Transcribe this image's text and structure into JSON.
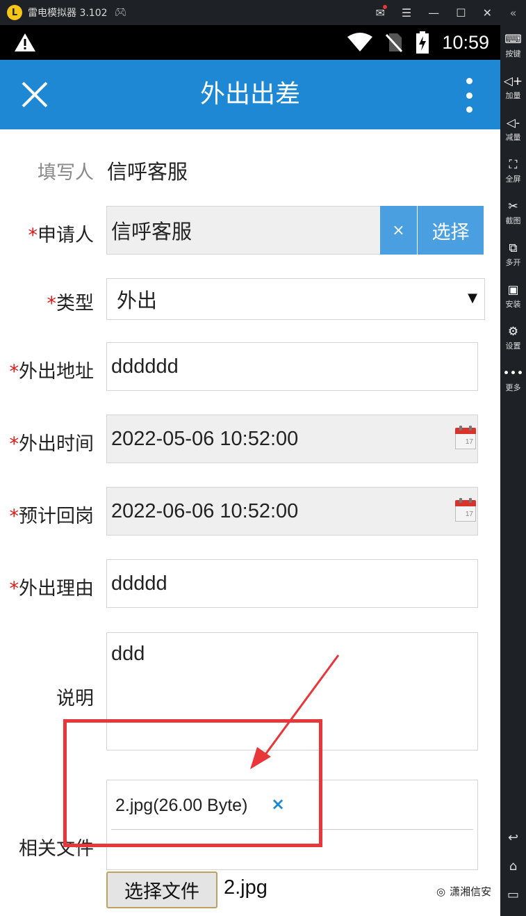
{
  "emulator": {
    "title": "雷电模拟器 3.102",
    "side_items": [
      {
        "icon": "keyboard-icon",
        "glyph": "⌨",
        "label": "按键"
      },
      {
        "icon": "volume-up-icon",
        "glyph": "◁+",
        "label": "加量"
      },
      {
        "icon": "volume-down-icon",
        "glyph": "◁-",
        "label": "减量"
      },
      {
        "icon": "fullscreen-icon",
        "glyph": "⛶",
        "label": "全屏"
      },
      {
        "icon": "scissors-icon",
        "glyph": "✂",
        "label": "截图"
      },
      {
        "icon": "multi-open-icon",
        "glyph": "⧉",
        "label": "多开"
      },
      {
        "icon": "apk-install-icon",
        "glyph": "▣",
        "label": "安装"
      },
      {
        "icon": "gear-icon",
        "glyph": "⚙",
        "label": "设置"
      },
      {
        "icon": "more-icon",
        "glyph": "•••",
        "label": "更多"
      }
    ]
  },
  "status_bar": {
    "time": "10:59"
  },
  "header": {
    "title": "外出出差"
  },
  "form": {
    "filler": {
      "label": "填写人",
      "value": "信呼客服"
    },
    "applicant": {
      "required": "*",
      "label": "申请人",
      "value": "信呼客服",
      "clear": "×",
      "choose": "选择"
    },
    "type": {
      "required": "*",
      "label": "类型",
      "value": "外出",
      "arrow": "▼"
    },
    "address": {
      "required": "*",
      "label": "外出地址",
      "value": "dddddd"
    },
    "out_time": {
      "required": "*",
      "label": "外出时间",
      "value": "2022-05-06 10:52:00",
      "cal_day": "17"
    },
    "return_time": {
      "required": "*",
      "label": "预计回岗",
      "value": "2022-06-06 10:52:00",
      "cal_day": "17"
    },
    "reason": {
      "required": "*",
      "label": "外出理由",
      "value": "ddddd"
    },
    "note": {
      "label": "说明",
      "value": "ddd"
    },
    "files": {
      "label": "相关文件",
      "item": "2.jpg(26.00 Byte)",
      "remove": "×",
      "pick_button": "选择文件",
      "picked": "2.jpg"
    }
  },
  "watermark": "潇湘信安",
  "colors": {
    "header": "#1e88d4",
    "required": "#e01818",
    "button": "#4a9fe0",
    "annotation": "#e8373b"
  }
}
